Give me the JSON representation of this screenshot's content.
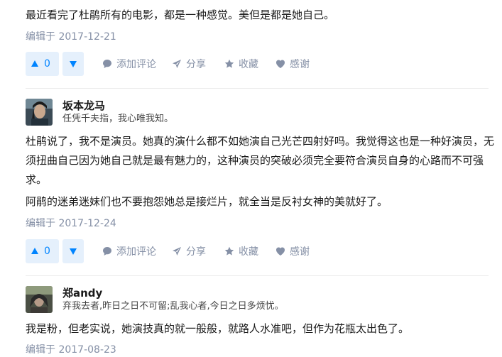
{
  "answers": [
    {
      "paragraphs": [
        "最近看完了杜鹃所有的电影，都是一种感觉。美但是都是她自己。"
      ],
      "edited": "编辑于 2017-12-21",
      "votes": "0",
      "actions": {
        "comment": "添加评论",
        "share": "分享",
        "collect": "收藏",
        "thanks": "感谢"
      }
    },
    {
      "author": {
        "name": "坂本龙马",
        "bio": "任凭千夫指，我心唯我知。"
      },
      "paragraphs": [
        "杜鹃说了，我不是演员。她真的演什么都不如她演自己光芒四射好吗。我觉得这也是一种好演员，无须扭曲自己因为她自己就是最有魅力的，这种演员的突破必须完全要符合演员自身的心路而不可强求。",
        "阿鹃的迷弟迷妹们也不要抱怨她总是接烂片，就全当是反衬女神的美就好了。"
      ],
      "edited": "编辑于 2017-12-24",
      "votes": "0",
      "actions": {
        "comment": "添加评论",
        "share": "分享",
        "collect": "收藏",
        "thanks": "感谢"
      }
    },
    {
      "author": {
        "name": "郑andy",
        "bio": "弃我去者,昨日之日不可留;乱我心者,今日之日多烦忧。"
      },
      "paragraphs": [
        "我是粉，但老实说，她演技真的就一般般，就路人水准吧，但作为花瓶太出色了。"
      ],
      "edited": "编辑于 2017-08-23"
    }
  ],
  "colors": {
    "accent": "#0084ff",
    "vote_bg": "#e5f0fc",
    "meta_gray": "#8590a6",
    "divider": "#ebebeb"
  }
}
